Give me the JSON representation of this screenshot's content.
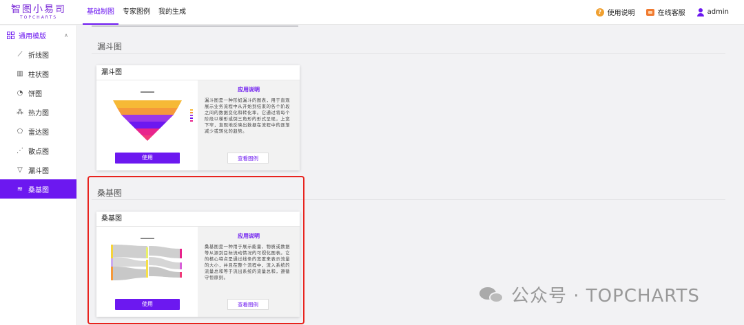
{
  "logo": {
    "cn": "智图小易司",
    "en": "TOPCHARTS"
  },
  "topnav": {
    "tabs": [
      "基础制图",
      "专家图例",
      "我的生成"
    ]
  },
  "header_right": {
    "help": "使用说明",
    "service": "在线客服",
    "user": "admin"
  },
  "sidebar": {
    "group": "通用模版",
    "items": [
      {
        "label": "折线图",
        "icon": "line-chart-icon"
      },
      {
        "label": "柱状图",
        "icon": "bar-chart-icon"
      },
      {
        "label": "饼图",
        "icon": "pie-chart-icon"
      },
      {
        "label": "热力图",
        "icon": "heatmap-icon"
      },
      {
        "label": "雷达图",
        "icon": "radar-chart-icon"
      },
      {
        "label": "散点图",
        "icon": "scatter-chart-icon"
      },
      {
        "label": "漏斗图",
        "icon": "funnel-chart-icon"
      },
      {
        "label": "桑基图",
        "icon": "sankey-chart-icon"
      }
    ],
    "active_index": 7
  },
  "sections": [
    {
      "title": "漏斗图",
      "card": {
        "name": "漏斗图",
        "desc_title": "应用说明",
        "desc": "漏斗图是一种形如漏斗的图表，用于直观展示业务流程中从开始到结束的各个阶段之间的数据变化和转化率。它通过将每个阶段以梯形或倒三角形的形式呈现，上宽下窄，直观地反映出数据在流程中的逐渐减少或转化的趋势。",
        "use_label": "使用",
        "example_label": "查看图例"
      }
    },
    {
      "title": "桑基图",
      "card": {
        "name": "桑基图",
        "desc_title": "应用说明",
        "desc": "桑基图是一种用于展示能量、物质或数据等从源到目标流动情况的可视化图表。它的核心特点是通过线条的宽度来表示流量的大小，并且在整个流程中，流入系统的流量总和等于流出系统的流量总和，遵循守恒原则。",
        "use_label": "使用",
        "example_label": "查看图例"
      }
    }
  ],
  "watermark": "公众号 · TOPCHARTS",
  "colors": {
    "accent": "#6c18f0",
    "highlight": "#e8231e"
  }
}
